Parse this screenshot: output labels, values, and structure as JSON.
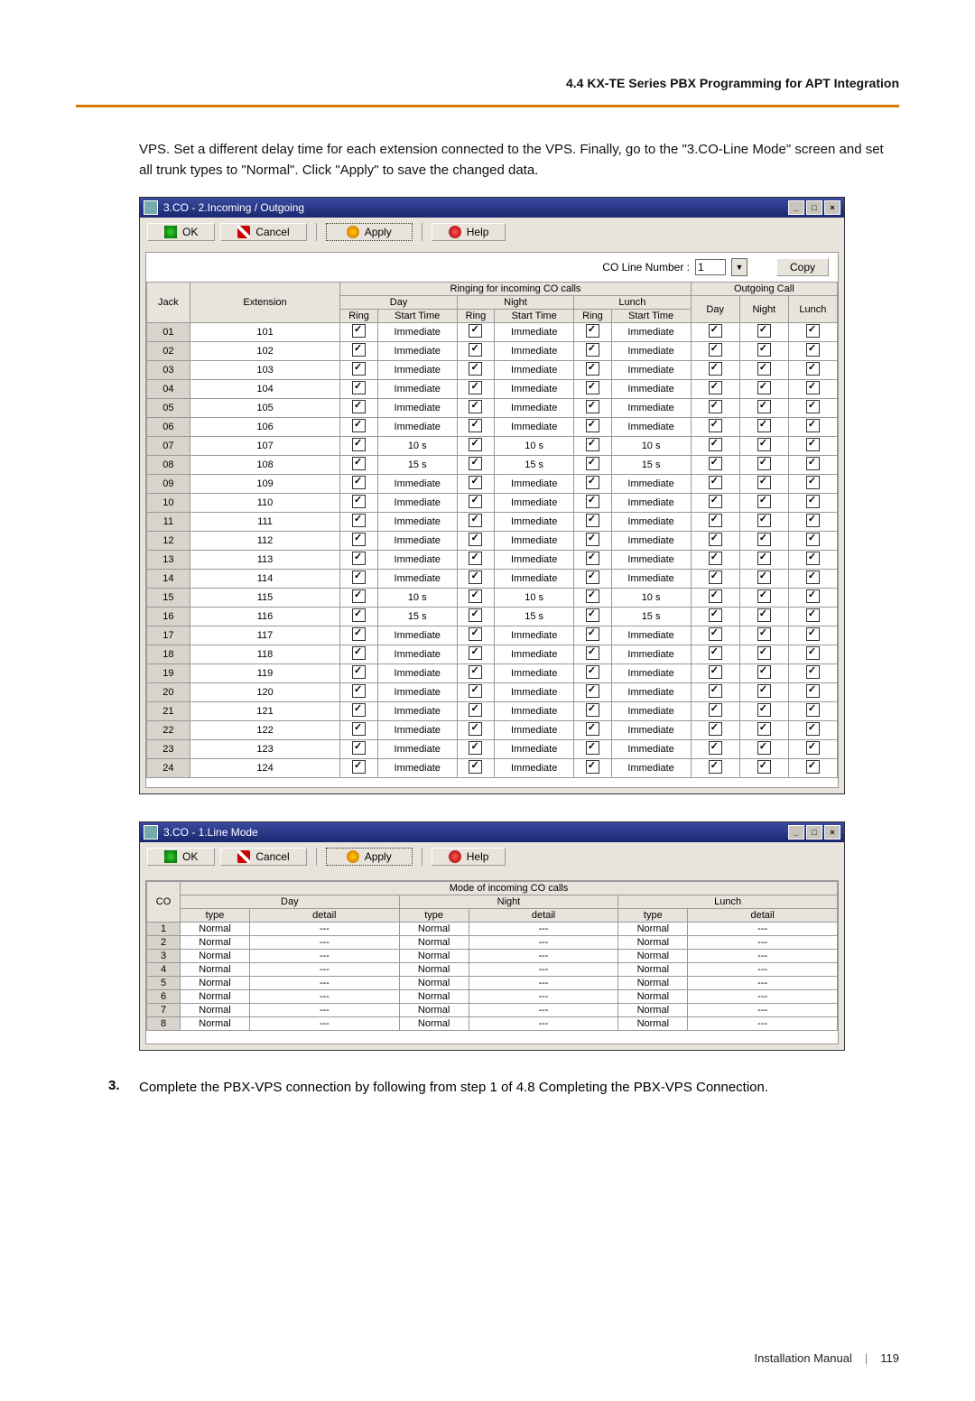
{
  "header": "4.4 KX-TE Series PBX Programming for APT Integration",
  "para1": "VPS. Set a different delay time for each extension connected to the VPS. Finally, go to the \"3.CO-Line Mode\" screen and set all trunk types to \"Normal\". Click \"Apply\" to save the changed data.",
  "step3": "Complete the PBX-VPS connection by following from step 1 of 4.8 Completing the PBX-VPS Connection.",
  "footer_label": "Installation Manual",
  "footer_page": "119",
  "win1": {
    "title": "3.CO - 2.Incoming / Outgoing",
    "toolbar": {
      "ok": "OK",
      "cancel": "Cancel",
      "apply": "Apply",
      "help": "Help"
    },
    "coline_label": "CO Line Number :",
    "coline_value": "1",
    "copy": "Copy",
    "headers": {
      "jack": "Jack",
      "ext": "Extension",
      "ringing": "Ringing for incoming CO calls",
      "outgoing": "Outgoing Call",
      "day": "Day",
      "night": "Night",
      "lunch": "Lunch",
      "ring": "Ring",
      "start": "Start Time"
    },
    "rows": [
      {
        "j": "01",
        "e": "101",
        "d": "Immediate",
        "n": "Immediate",
        "l": "Immediate"
      },
      {
        "j": "02",
        "e": "102",
        "d": "Immediate",
        "n": "Immediate",
        "l": "Immediate"
      },
      {
        "j": "03",
        "e": "103",
        "d": "Immediate",
        "n": "Immediate",
        "l": "Immediate"
      },
      {
        "j": "04",
        "e": "104",
        "d": "Immediate",
        "n": "Immediate",
        "l": "Immediate"
      },
      {
        "j": "05",
        "e": "105",
        "d": "Immediate",
        "n": "Immediate",
        "l": "Immediate"
      },
      {
        "j": "06",
        "e": "106",
        "d": "Immediate",
        "n": "Immediate",
        "l": "Immediate"
      },
      {
        "j": "07",
        "e": "107",
        "d": "10 s",
        "n": "10 s",
        "l": "10 s"
      },
      {
        "j": "08",
        "e": "108",
        "d": "15 s",
        "n": "15 s",
        "l": "15 s"
      },
      {
        "j": "09",
        "e": "109",
        "d": "Immediate",
        "n": "Immediate",
        "l": "Immediate"
      },
      {
        "j": "10",
        "e": "110",
        "d": "Immediate",
        "n": "Immediate",
        "l": "Immediate"
      },
      {
        "j": "11",
        "e": "111",
        "d": "Immediate",
        "n": "Immediate",
        "l": "Immediate"
      },
      {
        "j": "12",
        "e": "112",
        "d": "Immediate",
        "n": "Immediate",
        "l": "Immediate"
      },
      {
        "j": "13",
        "e": "113",
        "d": "Immediate",
        "n": "Immediate",
        "l": "Immediate"
      },
      {
        "j": "14",
        "e": "114",
        "d": "Immediate",
        "n": "Immediate",
        "l": "Immediate"
      },
      {
        "j": "15",
        "e": "115",
        "d": "10 s",
        "n": "10 s",
        "l": "10 s"
      },
      {
        "j": "16",
        "e": "116",
        "d": "15 s",
        "n": "15 s",
        "l": "15 s"
      },
      {
        "j": "17",
        "e": "117",
        "d": "Immediate",
        "n": "Immediate",
        "l": "Immediate"
      },
      {
        "j": "18",
        "e": "118",
        "d": "Immediate",
        "n": "Immediate",
        "l": "Immediate"
      },
      {
        "j": "19",
        "e": "119",
        "d": "Immediate",
        "n": "Immediate",
        "l": "Immediate"
      },
      {
        "j": "20",
        "e": "120",
        "d": "Immediate",
        "n": "Immediate",
        "l": "Immediate"
      },
      {
        "j": "21",
        "e": "121",
        "d": "Immediate",
        "n": "Immediate",
        "l": "Immediate"
      },
      {
        "j": "22",
        "e": "122",
        "d": "Immediate",
        "n": "Immediate",
        "l": "Immediate"
      },
      {
        "j": "23",
        "e": "123",
        "d": "Immediate",
        "n": "Immediate",
        "l": "Immediate"
      },
      {
        "j": "24",
        "e": "124",
        "d": "Immediate",
        "n": "Immediate",
        "l": "Immediate"
      }
    ]
  },
  "win2": {
    "title": "3.CO - 1.Line Mode",
    "toolbar": {
      "ok": "OK",
      "cancel": "Cancel",
      "apply": "Apply",
      "help": "Help"
    },
    "headers": {
      "co": "CO",
      "mode": "Mode of incoming CO calls",
      "day": "Day",
      "night": "Night",
      "lunch": "Lunch",
      "type": "type",
      "detail": "detail"
    },
    "rows": [
      {
        "c": "1"
      },
      {
        "c": "2"
      },
      {
        "c": "3"
      },
      {
        "c": "4"
      },
      {
        "c": "5"
      },
      {
        "c": "6"
      },
      {
        "c": "7"
      },
      {
        "c": "8"
      }
    ],
    "normal": "Normal",
    "dash": "---"
  }
}
